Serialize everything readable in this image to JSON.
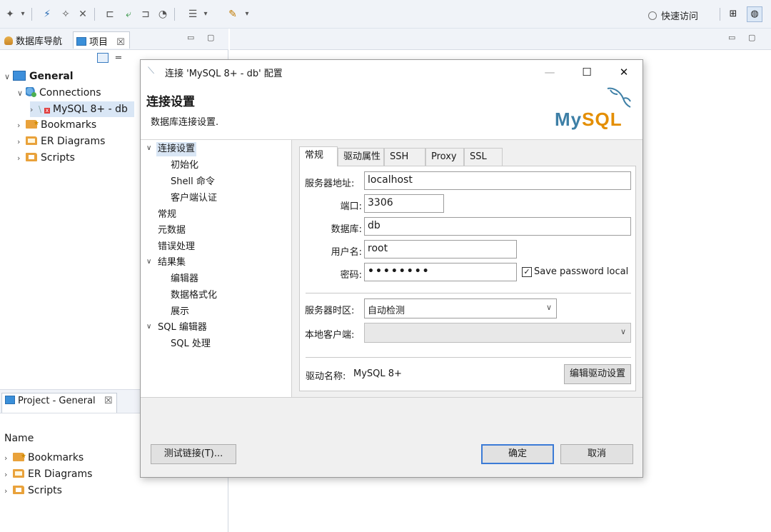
{
  "toolbar": {
    "quick_access": "快速访问"
  },
  "left_view": {
    "tabs": [
      {
        "label": "数据库导航"
      },
      {
        "label": "项目",
        "close": "☒"
      }
    ],
    "tree": {
      "root": "General",
      "connections": "Connections",
      "connection": "MySQL 8+ - db",
      "bookmarks": "Bookmarks",
      "er_diagrams": "ER Diagrams",
      "scripts": "Scripts"
    }
  },
  "bottom_view": {
    "tab": "Project - General",
    "tab_close": "☒",
    "column_header": "Name",
    "items": [
      "Bookmarks",
      "ER Diagrams",
      "Scripts"
    ]
  },
  "dialog": {
    "title": "连接 'MySQL 8+ - db' 配置",
    "header_title": "连接设置",
    "header_subtitle": "数据库连接设置.",
    "logo_my": "My",
    "logo_sql": "SQL",
    "nav": {
      "conn_settings": "连接设置",
      "init": "初始化",
      "shell": "Shell 命令",
      "client_auth": "客户端认证",
      "general": "常规",
      "metadata": "元数据",
      "error_handling": "错误处理",
      "result_sets": "结果集",
      "editors": "编辑器",
      "data_format": "数据格式化",
      "presentation": "展示",
      "sql_editor": "SQL 编辑器",
      "sql_processing": "SQL 处理"
    },
    "tabs": [
      "常规",
      "驱动属性",
      "SSH",
      "Proxy",
      "SSL"
    ],
    "form": {
      "host_label": "服务器地址:",
      "host_value": "localhost",
      "port_label": "端口:",
      "port_value": "3306",
      "database_label": "数据库:",
      "database_value": "db",
      "user_label": "用户名:",
      "user_value": "root",
      "password_label": "密码:",
      "password_value": "••••••••",
      "save_password_label": "Save password local",
      "save_password_checked": true,
      "timezone_label": "服务器时区:",
      "timezone_value": "自动检测",
      "local_client_label": "本地客户端:",
      "local_client_value": "",
      "driver_name_label": "驱动名称:",
      "driver_name_value": "MySQL 8+",
      "edit_driver_button": "编辑驱动设置"
    },
    "buttons": {
      "test": "测试链接(T)...",
      "ok": "确定",
      "cancel": "取消"
    }
  }
}
